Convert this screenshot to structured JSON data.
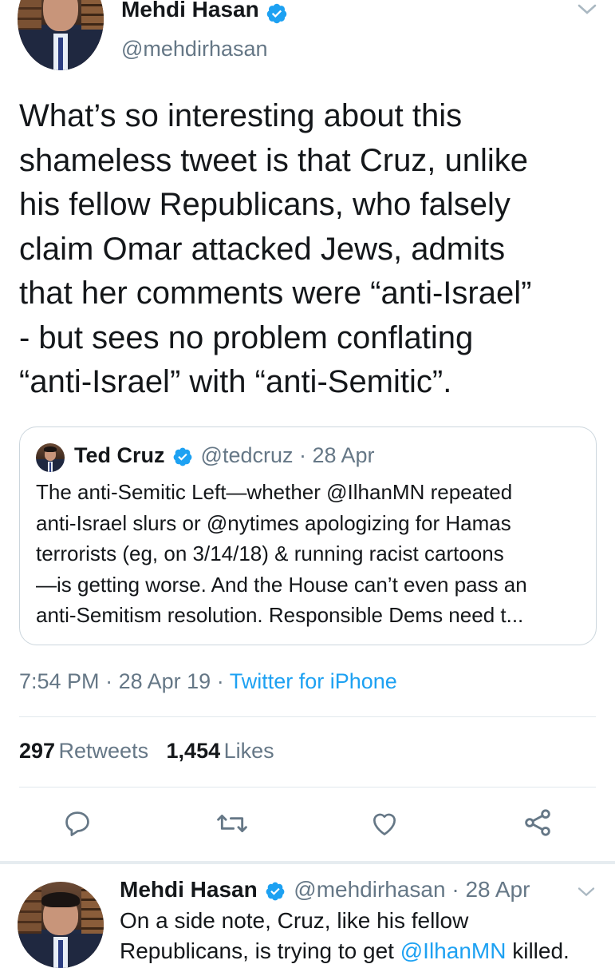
{
  "main_tweet": {
    "author_name": "Mehdi Hasan",
    "author_handle": "@mehdirhasan",
    "text_lines": [
      "What’s so interesting about this",
      "shameless tweet is that Cruz, unlike",
      "his fellow Republicans, who falsely",
      "claim Omar attacked Jews, admits",
      "that her comments were “anti-Israel”",
      "- but sees no problem conflating",
      "“anti-Israel” with “anti-Semitic”."
    ],
    "time": "7:54 PM",
    "date": "28 Apr 19",
    "sep1": "·",
    "sep2": "·",
    "source": "Twitter for iPhone",
    "retweets_count": "297",
    "retweets_label": "Retweets",
    "likes_count": "1,454",
    "likes_label": "Likes"
  },
  "quoted_tweet": {
    "author_name": "Ted Cruz",
    "author_handle": "@tedcruz",
    "date": "· 28 Apr",
    "text_lines": [
      "The anti-Semitic Left—whether @IlhanMN repeated",
      "anti-Israel slurs or @nytimes apologizing for Hamas",
      "terrorists (eg, on 3/14/18) & running racist cartoons",
      "—is getting worse. And the House can’t even pass an",
      "anti-Semitism resolution. Responsible Dems need t..."
    ]
  },
  "actions": {
    "reply_icon": "reply-icon",
    "retweet_icon": "retweet-icon",
    "like_icon": "heart-icon",
    "share_icon": "share-icon"
  },
  "reply_tweet": {
    "author_name": "Mehdi Hasan",
    "author_handle": "@mehdirhasan",
    "date": "· 28 Apr",
    "line1": "On a side note, Cruz, like his fellow",
    "line2_prefix": "Republicans, is trying to get ",
    "line2_mention": "@IlhanMN",
    "line2_suffix": " killed."
  },
  "colors": {
    "verified_blue": "#1da1f2",
    "link_blue": "#1da1f2",
    "secondary_text": "#657786"
  }
}
